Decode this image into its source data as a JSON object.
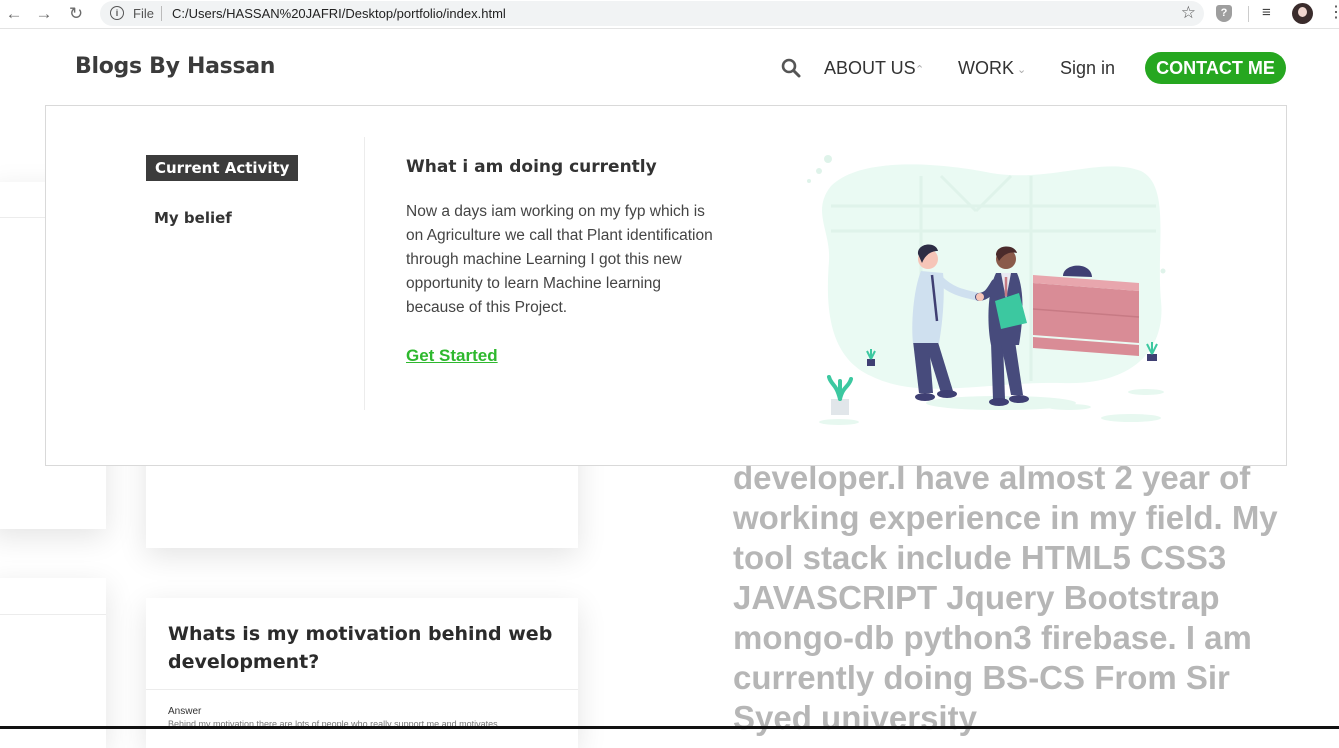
{
  "browser": {
    "back_icon": "arrow-left-icon",
    "forward_icon": "arrow-right-icon",
    "reload_icon": "reload-icon",
    "info_icon": "info-icon",
    "file_label": "File",
    "url": "C:/Users/HASSAN%20JAFRI/Desktop/portfolio/index.html",
    "bookmark_icon": "star-icon"
  },
  "site": {
    "brand": "Blogs By Hassan",
    "nav": {
      "about": "ABOUT US",
      "work": "WORK",
      "signin": "Sign in",
      "contact": "CONTACT ME"
    }
  },
  "dropdown": {
    "tabs": [
      "Current Activity",
      "My belief"
    ],
    "title": "What i am doing currently",
    "body": "Now a days iam working on my fyp which is on Agriculture we call that Plant identification through machine Learning I got this new opportunity to learn Machine learning because of this Project.",
    "cta": "Get Started"
  },
  "background": {
    "card_title": "Whats is my motivation behind web development?",
    "answer_label": "Answer",
    "answer_text": "Behind my motivation there are lots of people who really support me and motivates",
    "about_text": "developer.I have almost 2 year of working experience in my field. My tool stack include HTML5 CSS3 JAVASCRIPT Jquery Bootstrap mongo-db python3 firebase. I am currently doing BS-CS From Sir Syed university"
  },
  "colors": {
    "accent": "#26a720",
    "link": "#2eb82e",
    "tab_active_bg": "#3c3c3c"
  }
}
